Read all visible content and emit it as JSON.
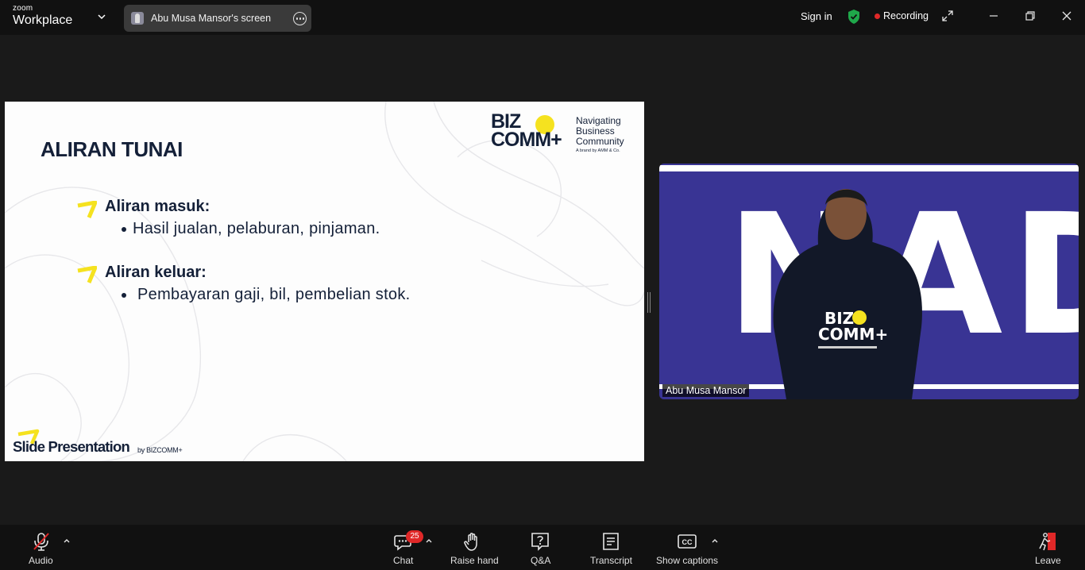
{
  "titlebar": {
    "brand_small": "zoom",
    "brand_big": "Workplace",
    "share_label": "Abu Musa Mansor's screen",
    "sign_in": "Sign in",
    "recording": "Recording"
  },
  "slide": {
    "title": "ALIRAN TUNAI",
    "logo_line1": "BIZ",
    "logo_line2": "COMM+",
    "tagline1": "Navigating",
    "tagline2": "Business",
    "tagline3": "Community",
    "tagline_sub": "A brand by AMM & Co.",
    "items": [
      {
        "heading": "Aliran masuk:",
        "detail": "Hasil jualan, pelaburan, pinjaman."
      },
      {
        "heading": "Aliran keluar:",
        "detail": "Pembayaran gaji, bil, pembelian stok."
      }
    ],
    "footer_brand": "Slide Presentation",
    "footer_by": "by BIZCOMM+"
  },
  "video": {
    "backdrop_text": "NADI",
    "participant_name": "Abu Musa Mansor"
  },
  "toolbar": {
    "audio": "Audio",
    "chat": "Chat",
    "chat_badge": "25",
    "raise_hand": "Raise hand",
    "qa": "Q&A",
    "transcript": "Transcript",
    "captions": "Show captions",
    "leave": "Leave"
  },
  "colors": {
    "slide_navy": "#142038",
    "accent_yellow": "#f5e21f",
    "recording_red": "#e02828",
    "secure_green": "#1fa84a",
    "video_backdrop": "#393494"
  }
}
